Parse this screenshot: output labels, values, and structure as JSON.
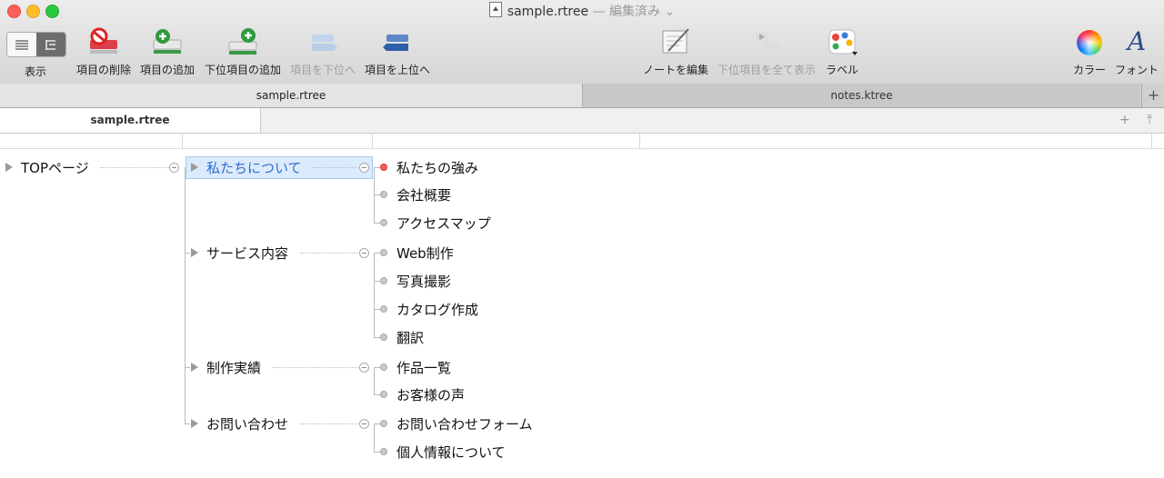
{
  "window": {
    "title": "sample.rtree",
    "subtitle": "— 編集済み ⌄"
  },
  "toolbar": {
    "view": "表示",
    "delete": "項目の削除",
    "add": "項目の追加",
    "add_child": "下位項目の追加",
    "move_down": "項目を下位へ",
    "move_up": "項目を上位へ",
    "edit_note": "ノートを編集",
    "show_all_children": "下位項目を全て表示",
    "label": "ラベル",
    "color": "カラー",
    "font": "フォント"
  },
  "tabs": [
    {
      "label": "sample.rtree"
    },
    {
      "label": "notes.ktree"
    }
  ],
  "subtab": {
    "label": "sample.rtree"
  },
  "tree": {
    "root": "TOPページ",
    "l1": [
      "私たちについて",
      "サービス内容",
      "制作実績",
      "お問い合わせ"
    ],
    "l2": {
      "about": [
        "私たちの強み",
        "会社概要",
        "アクセスマップ"
      ],
      "services": [
        "Web制作",
        "写真撮影",
        "カタログ作成",
        "翻訳"
      ],
      "works": [
        "作品一覧",
        "お客様の声"
      ],
      "contact": [
        "お問い合わせフォーム",
        "個人情報について"
      ]
    }
  },
  "colors": {
    "selected_text": "#2f6fce",
    "selected_bg": "#dbeafc",
    "label_red": "#f05d5d"
  }
}
